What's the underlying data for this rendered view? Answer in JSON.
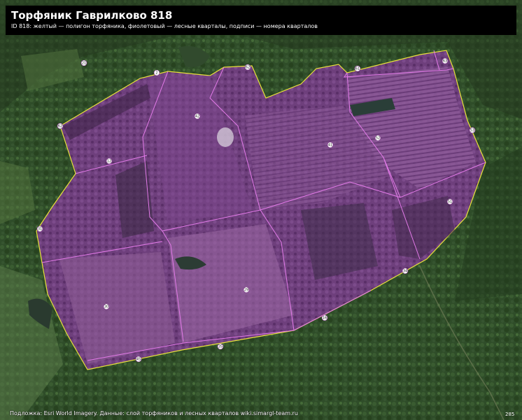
{
  "title": "Торфяник Гаврилково 818",
  "subtitle": "ID 818: желтый — полигон торфяника, фиолетовый — лесные кварталы, подписи — номера кварталов",
  "attribution": "Подложка: Esri World Imagery. Данные: слой торфяников и лесных кварталов wiki.simargl-team.ru",
  "corner_label": "285",
  "colors": {
    "peat_outline": "#e8e23a",
    "quarter_line": "#e27ae8",
    "quarter_fill": "#8a3a9e",
    "forest": "#2f4e2a"
  },
  "quarter_labels": [
    "2",
    "62",
    "61",
    "63",
    "42",
    "12",
    "41",
    "52",
    "53",
    "51",
    "31",
    "29",
    "30",
    "16",
    "34",
    "35",
    "45",
    "62",
    "21"
  ]
}
